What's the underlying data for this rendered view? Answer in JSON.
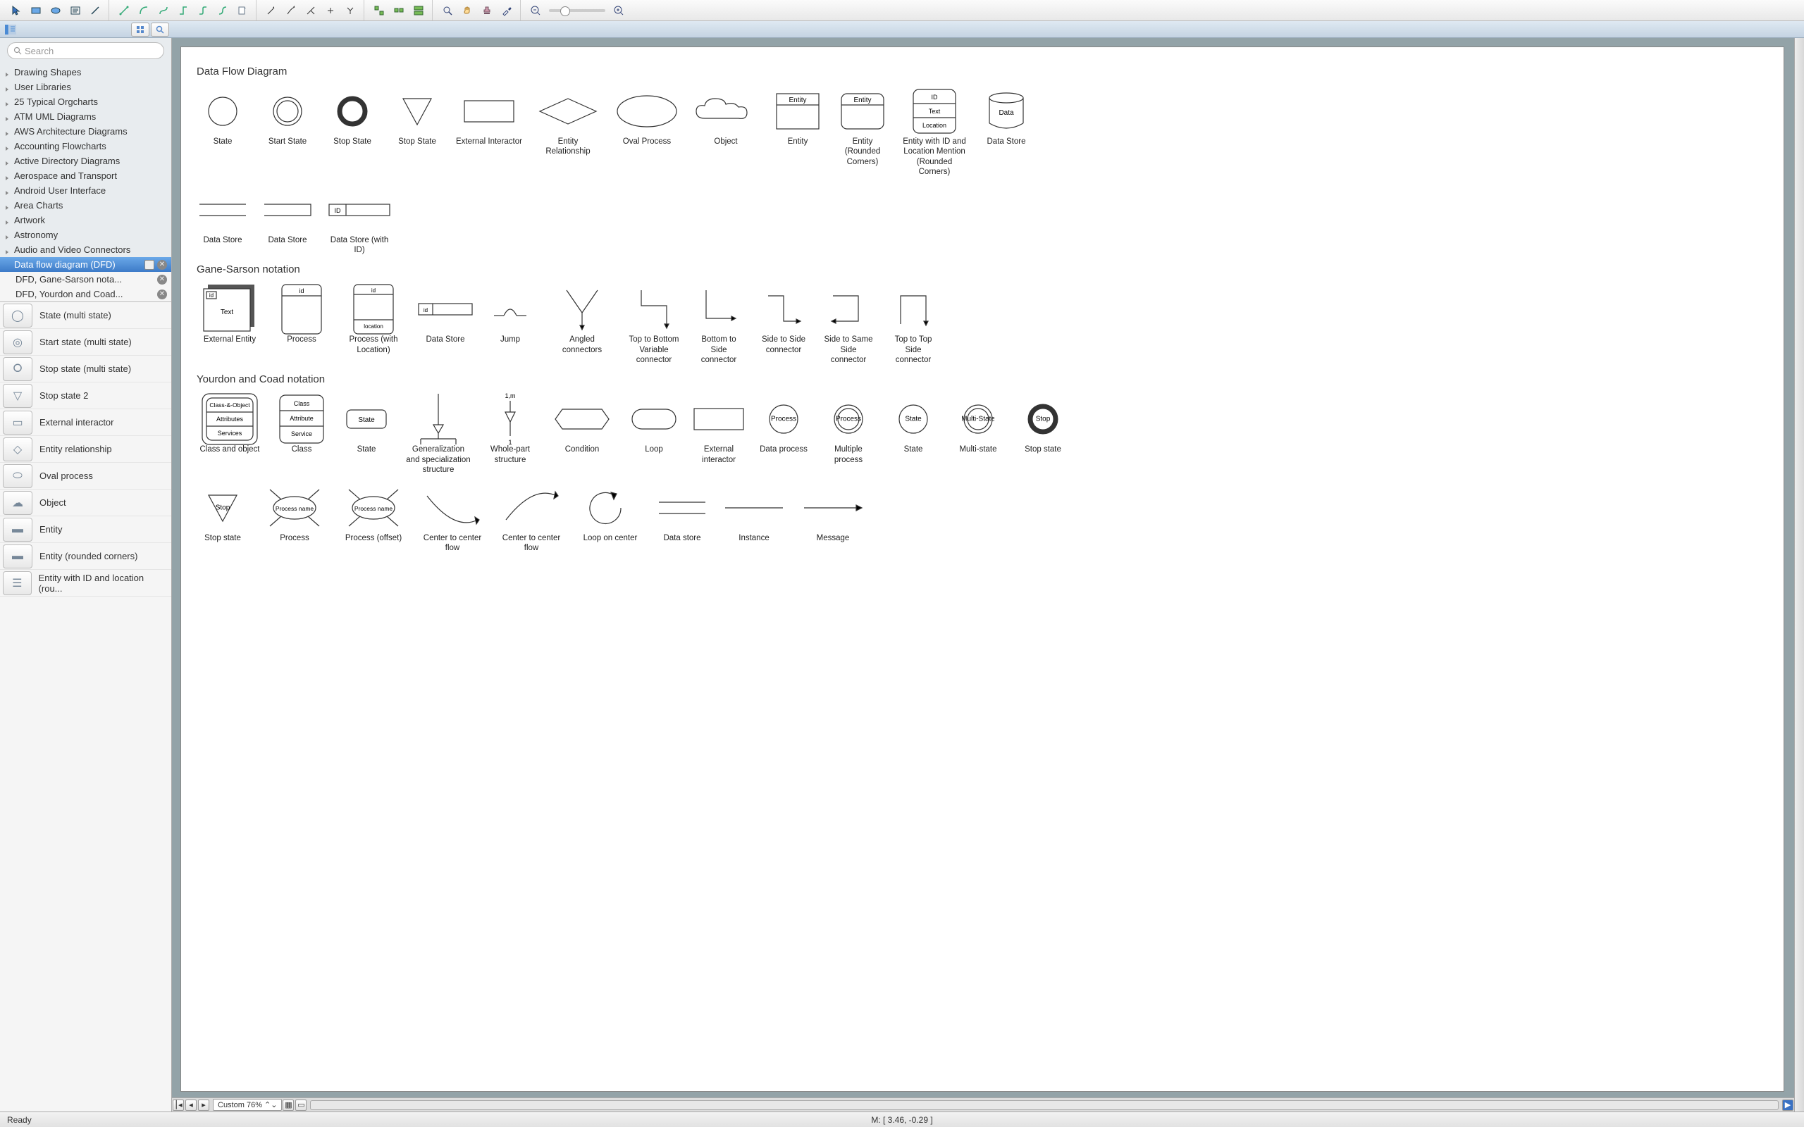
{
  "toolbar": {
    "groups": [
      [
        {
          "n": "pointer"
        },
        {
          "n": "rect"
        },
        {
          "n": "ellipse"
        },
        {
          "n": "text"
        },
        {
          "n": "line"
        }
      ],
      [
        {
          "n": "connector-1"
        },
        {
          "n": "connector-2"
        },
        {
          "n": "connector-3"
        },
        {
          "n": "connector-4"
        },
        {
          "n": "connector-5"
        },
        {
          "n": "connector-6"
        },
        {
          "n": "connector-7"
        }
      ],
      [
        {
          "n": "arrow-line"
        },
        {
          "n": "arrow-curve"
        },
        {
          "n": "arrow-multi"
        },
        {
          "n": "arrow-bi"
        },
        {
          "n": "arrow-split"
        }
      ],
      [
        {
          "n": "align-1"
        },
        {
          "n": "align-2"
        },
        {
          "n": "align-3"
        }
      ],
      [
        {
          "n": "zoom-tool"
        },
        {
          "n": "hand-tool"
        },
        {
          "n": "stamp-tool"
        },
        {
          "n": "dropper-tool"
        }
      ]
    ]
  },
  "search": {
    "placeholder": "Search"
  },
  "tree": [
    {
      "label": "Drawing Shapes",
      "expanded": false
    },
    {
      "label": "User Libraries",
      "expanded": false
    },
    {
      "label": "25 Typical Orgcharts",
      "expanded": false
    },
    {
      "label": "ATM UML Diagrams",
      "expanded": false
    },
    {
      "label": "AWS Architecture Diagrams",
      "expanded": false
    },
    {
      "label": "Accounting Flowcharts",
      "expanded": false
    },
    {
      "label": "Active Directory Diagrams",
      "expanded": false
    },
    {
      "label": "Aerospace and Transport",
      "expanded": false
    },
    {
      "label": "Android User Interface",
      "expanded": false
    },
    {
      "label": "Area Charts",
      "expanded": false
    },
    {
      "label": "Artwork",
      "expanded": false
    },
    {
      "label": "Astronomy",
      "expanded": false
    },
    {
      "label": "Audio and Video Connectors",
      "expanded": false
    }
  ],
  "active_lib": {
    "title": "Data flow diagram (DFD)",
    "subs": [
      "DFD, Gane-Sarson nota...",
      "DFD, Yourdon and Coad..."
    ]
  },
  "shapes_list": [
    {
      "label": "State (multi state)",
      "icon": "circle"
    },
    {
      "label": "Start state (multi state)",
      "icon": "dblcircle"
    },
    {
      "label": "Stop state (multi state)",
      "icon": "thickring"
    },
    {
      "label": "Stop state 2",
      "icon": "triangle"
    },
    {
      "label": "External interactor",
      "icon": "rect"
    },
    {
      "label": "Entity relationship",
      "icon": "diamond"
    },
    {
      "label": "Oval process",
      "icon": "oval"
    },
    {
      "label": "Object",
      "icon": "cloud"
    },
    {
      "label": "Entity",
      "icon": "entity"
    },
    {
      "label": "Entity (rounded corners)",
      "icon": "entity-round"
    },
    {
      "label": "Entity with ID and location (rou...",
      "icon": "entity-3"
    }
  ],
  "sections": [
    {
      "title": "Data Flow Diagram",
      "rows": [
        [
          {
            "label": "State",
            "svg": "circle"
          },
          {
            "label": "Start State",
            "svg": "dblcircle"
          },
          {
            "label": "Stop State",
            "svg": "thickring"
          },
          {
            "label": "Stop State",
            "svg": "triangle"
          },
          {
            "label": "External Interactor",
            "svg": "rect",
            "wide": true
          },
          {
            "label": "Entity Relationship",
            "svg": "diamond",
            "wide": true
          },
          {
            "label": "Oval Process",
            "svg": "oval",
            "wide": true
          },
          {
            "label": "Object",
            "svg": "cloud",
            "wide": true
          },
          {
            "label": "Entity",
            "svg": "entity",
            "text": "Entity"
          },
          {
            "label": "Entity (Rounded Corners)",
            "svg": "entity-round",
            "text": "Entity"
          },
          {
            "label": "Entity with ID and Location Mention (Rounded Corners)",
            "svg": "entity-3",
            "wide": true
          },
          {
            "label": "Data Store",
            "svg": "cylinder",
            "text": "Data"
          }
        ],
        [
          {
            "label": "Data Store",
            "svg": "dstore"
          },
          {
            "label": "Data Store",
            "svg": "dstore-open"
          },
          {
            "label": "Data Store (with ID)",
            "svg": "dstore-id",
            "text": "ID",
            "wide": true
          }
        ]
      ]
    },
    {
      "title": "Gane-Sarson notation",
      "rows": [
        [
          {
            "label": "External Entity",
            "svg": "extentity",
            "text": "Text",
            "wide": true
          },
          {
            "label": "Process",
            "svg": "process-gs",
            "text": "id"
          },
          {
            "label": "Process (with Location)",
            "svg": "process-loc",
            "wide": true
          },
          {
            "label": "Data Store",
            "svg": "dstore-gs",
            "text": "id"
          },
          {
            "label": "Jump",
            "svg": "jump"
          },
          {
            "label": "Angled connectors",
            "svg": "conn-angled",
            "wide": true
          },
          {
            "label": "Top to Bottom Variable connector",
            "svg": "conn-tb"
          },
          {
            "label": "Bottom to Side connector",
            "svg": "conn-bs"
          },
          {
            "label": "Side to Side connector",
            "svg": "conn-ss"
          },
          {
            "label": "Side to Same Side connector",
            "svg": "conn-sss"
          },
          {
            "label": "Top to Top Side connector",
            "svg": "conn-tt"
          }
        ]
      ]
    },
    {
      "title": "Yourdon and Coad notation",
      "rows": [
        [
          {
            "label": "Class and object",
            "svg": "class-obj",
            "wide": true
          },
          {
            "label": "Class",
            "svg": "class-yc"
          },
          {
            "label": "State",
            "svg": "state-box",
            "text": "State"
          },
          {
            "label": "Generalization and specialization structure",
            "svg": "gen-spec",
            "wide": true
          },
          {
            "label": "Whole-part structure",
            "svg": "whole-part"
          },
          {
            "label": "Condition",
            "svg": "condition",
            "wide": true
          },
          {
            "label": "Loop",
            "svg": "loop"
          },
          {
            "label": "External interactor",
            "svg": "rect"
          },
          {
            "label": "Data process",
            "svg": "circle",
            "text": "Process"
          },
          {
            "label": "Multiple process",
            "svg": "dblcircle",
            "text": "Process"
          },
          {
            "label": "State",
            "svg": "circle",
            "text": "State"
          },
          {
            "label": "Multi-state",
            "svg": "dblcircle",
            "text": "Multi-State"
          },
          {
            "label": "Stop state",
            "svg": "thickring",
            "text": "Stop"
          }
        ],
        [
          {
            "label": "Stop state",
            "svg": "triangle",
            "text": "Stop"
          },
          {
            "label": "Process",
            "svg": "process-star",
            "text": "Process name",
            "wide": true
          },
          {
            "label": "Process (offset)",
            "svg": "process-star",
            "text": "Process name",
            "wide": true
          },
          {
            "label": "Center to center flow",
            "svg": "ccflow",
            "wide": true
          },
          {
            "label": "Center to center flow",
            "svg": "ccflow2",
            "wide": true
          },
          {
            "label": "Loop on center",
            "svg": "loop-center",
            "wide": true
          },
          {
            "label": "Data store",
            "svg": "dstore"
          },
          {
            "label": "Instance",
            "svg": "instance",
            "wide": true
          },
          {
            "label": "Message",
            "svg": "message",
            "wide": true
          }
        ]
      ]
    }
  ],
  "zoom_label": "Custom 76%",
  "status_ready": "Ready",
  "status_mouse": "M: [ 3.46, -0.29 ]",
  "entity3": {
    "row1": "ID",
    "row2": "Text",
    "row3": "Location"
  },
  "proc_loc": {
    "id": "id",
    "loc": "location"
  },
  "class_obj": {
    "r1": "Class-&-Object",
    "r2": "Attributes",
    "r3": "Services"
  },
  "class_yc": {
    "r1": "Class",
    "r2": "Attribute",
    "r3": "Service"
  },
  "whole_part": {
    "top": "1,m",
    "bot": "1"
  },
  "ext_entity_id": "id"
}
